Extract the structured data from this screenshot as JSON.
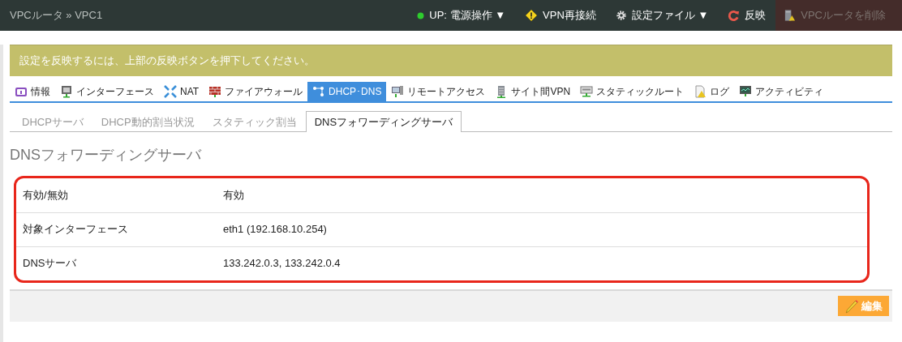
{
  "breadcrumb": "VPCルータ » VPC1",
  "toolbar": [
    {
      "kind": "status",
      "label": "UP: 電源操作 ▼",
      "disabled": false
    },
    {
      "kind": "warning",
      "label": "VPN再接続",
      "disabled": false
    },
    {
      "kind": "gear",
      "label": "設定ファイル ▼",
      "disabled": false
    },
    {
      "kind": "refresh",
      "label": "反映",
      "disabled": false
    },
    {
      "kind": "delete",
      "label": "VPCルータを削除",
      "disabled": true
    }
  ],
  "alert": "設定を反映するには、上部の反映ボタンを押下してください。",
  "tabs": [
    {
      "label": "情報",
      "selected": false
    },
    {
      "label": "インターフェース",
      "selected": false
    },
    {
      "label": "NAT",
      "selected": false
    },
    {
      "label": "ファイアウォール",
      "selected": false
    },
    {
      "label": "DHCP･DNS",
      "selected": true
    },
    {
      "label": "リモートアクセス",
      "selected": false
    },
    {
      "label": "サイト間VPN",
      "selected": false
    },
    {
      "label": "スタティックルート",
      "selected": false
    },
    {
      "label": "ログ",
      "selected": false
    },
    {
      "label": "アクティビティ",
      "selected": false
    }
  ],
  "subtabs": [
    {
      "label": "DHCPサーバ",
      "selected": false
    },
    {
      "label": "DHCP動的割当状況",
      "selected": false
    },
    {
      "label": "スタティック割当",
      "selected": false
    },
    {
      "label": "DNSフォワーディングサーバ",
      "selected": true
    }
  ],
  "heading": "DNSフォワーディングサーバ",
  "rows": [
    {
      "label": "有効/無効",
      "value": "有効"
    },
    {
      "label": "対象インターフェース",
      "value": "eth1 (192.168.10.254)"
    },
    {
      "label": "DNSサーバ",
      "value": "133.242.0.3, 133.242.0.4"
    }
  ],
  "edit_button": "編集"
}
